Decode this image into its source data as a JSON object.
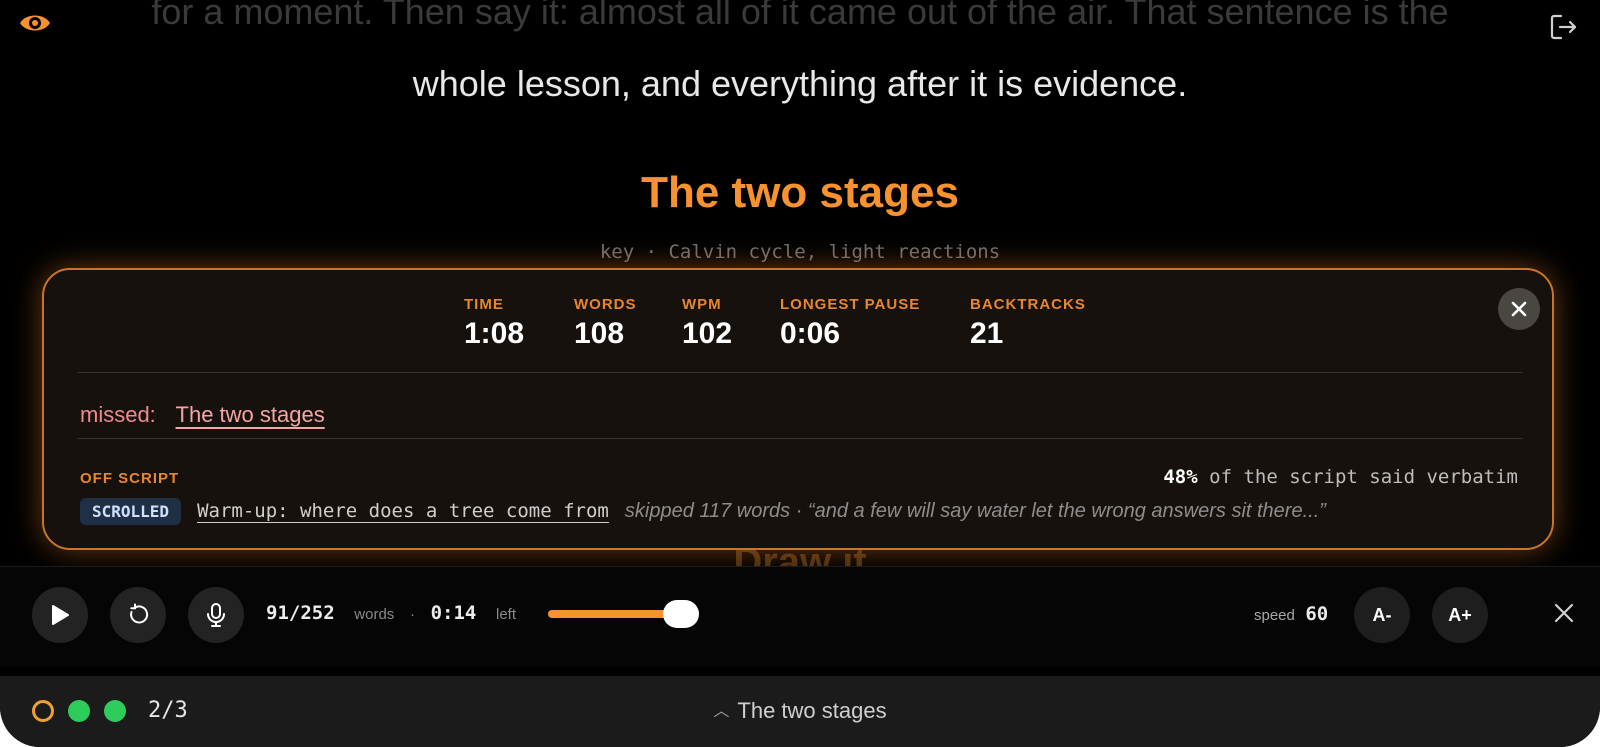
{
  "script": {
    "faded_line": "for a moment. Then say it: almost all of it came out of the air. That sentence is the",
    "current_line": "whole lesson, and everything after it is evidence.",
    "section_heading": "The two stages",
    "key_line": "key · Calvin cycle, light reactions",
    "next_heading": "Draw it"
  },
  "stats_panel": {
    "stats": [
      {
        "label": "TIME",
        "value": "1:08"
      },
      {
        "label": "WORDS",
        "value": "108"
      },
      {
        "label": "WPM",
        "value": "102"
      },
      {
        "label": "LONGEST PAUSE",
        "value": "0:06"
      },
      {
        "label": "BACKTRACKS",
        "value": "21"
      }
    ],
    "missed_label": "missed:",
    "missed_item": "The two stages",
    "off_script_label": "OFF SCRIPT",
    "verbatim_pct": "48%",
    "verbatim_text": "of the script said verbatim",
    "scrolled_badge": "SCROLLED",
    "scrolled_section": "Warm-up: where does a tree come from",
    "skipped_text": "skipped 117 words · “and a few will say water let the wrong answers sit there...”"
  },
  "player": {
    "words_progress": "91/252",
    "words_label": "words",
    "separator": "·",
    "time_left": "0:14",
    "left_label": "left",
    "slider_fraction": 0.9,
    "speed_label": "speed",
    "speed_value": "60",
    "font_smaller": "A-",
    "font_larger": "A+"
  },
  "footer": {
    "slide_count": "2/3",
    "current_section": "The two stages"
  },
  "colors": {
    "accent": "#f7922e",
    "done": "#2ecc5b",
    "missed": "#f08a8a"
  }
}
